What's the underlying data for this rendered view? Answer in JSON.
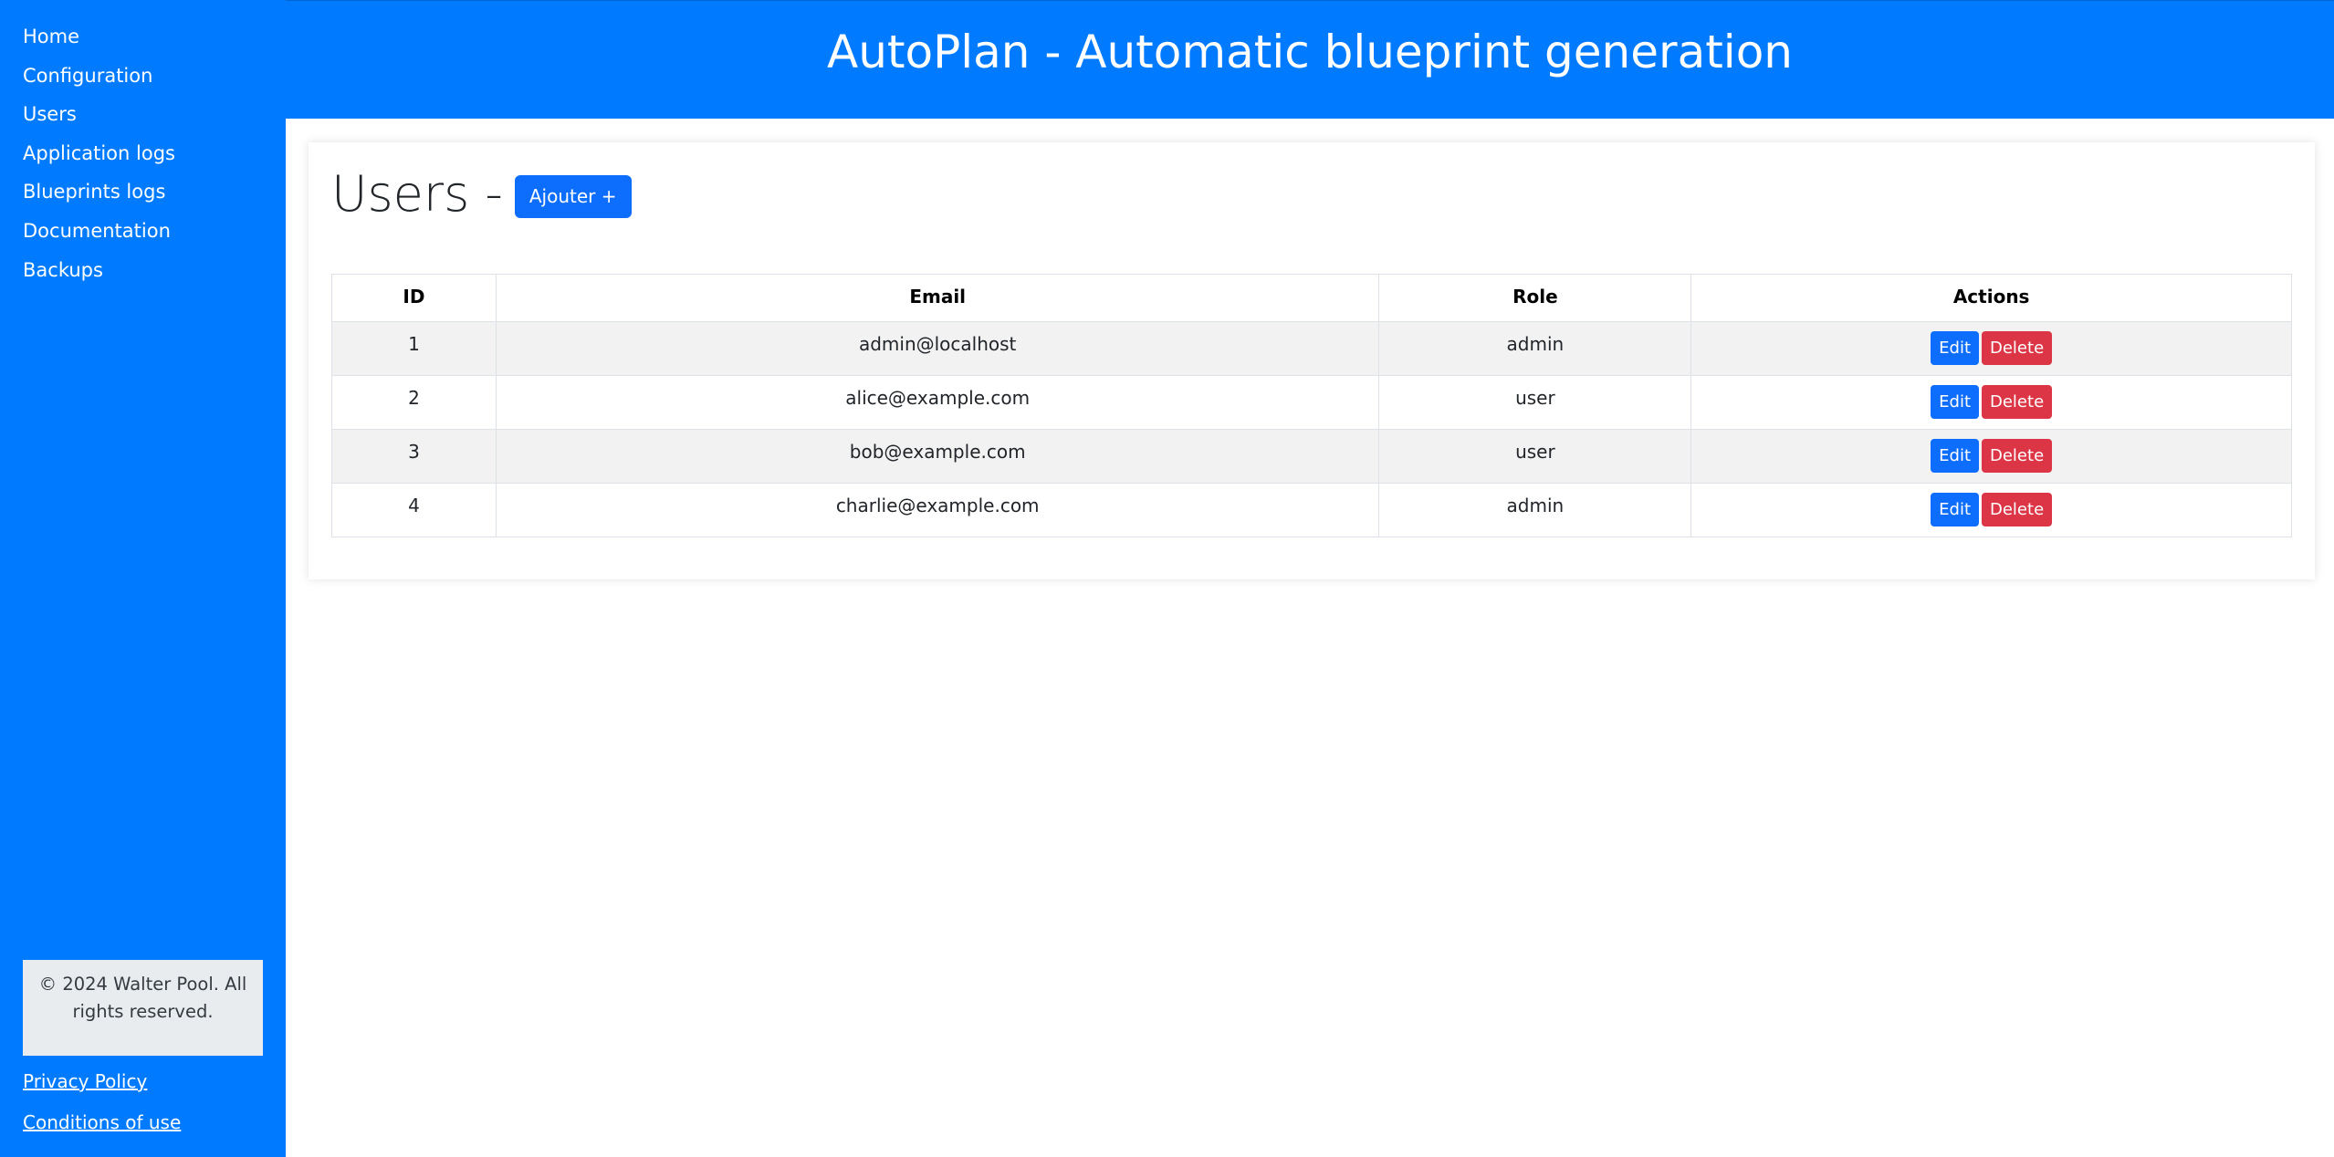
{
  "sidebar": {
    "items": [
      {
        "label": "Home"
      },
      {
        "label": "Configuration"
      },
      {
        "label": "Users"
      },
      {
        "label": "Application logs"
      },
      {
        "label": "Blueprints logs"
      },
      {
        "label": "Documentation"
      },
      {
        "label": "Backups"
      }
    ],
    "footer_text": "© 2024 Walter Pool. All rights reserved.",
    "privacy_link": "Privacy Policy",
    "conditions_link": "Conditions of use"
  },
  "header": {
    "title": "AutoPlan - Automatic blueprint generation"
  },
  "main": {
    "page_title": "Users -",
    "add_button_label": "Ajouter +",
    "table": {
      "columns": [
        "ID",
        "Email",
        "Role",
        "Actions"
      ],
      "rows": [
        {
          "id": "1",
          "email": "admin@localhost",
          "role": "admin"
        },
        {
          "id": "2",
          "email": "alice@example.com",
          "role": "user"
        },
        {
          "id": "3",
          "email": "bob@example.com",
          "role": "user"
        },
        {
          "id": "4",
          "email": "charlie@example.com",
          "role": "admin"
        }
      ],
      "edit_label": "Edit",
      "delete_label": "Delete"
    }
  },
  "colors": {
    "brand_blue": "#007bff",
    "primary_button": "#0d6efd",
    "danger_button": "#dc3545",
    "footer_box": "#e9ecef"
  }
}
